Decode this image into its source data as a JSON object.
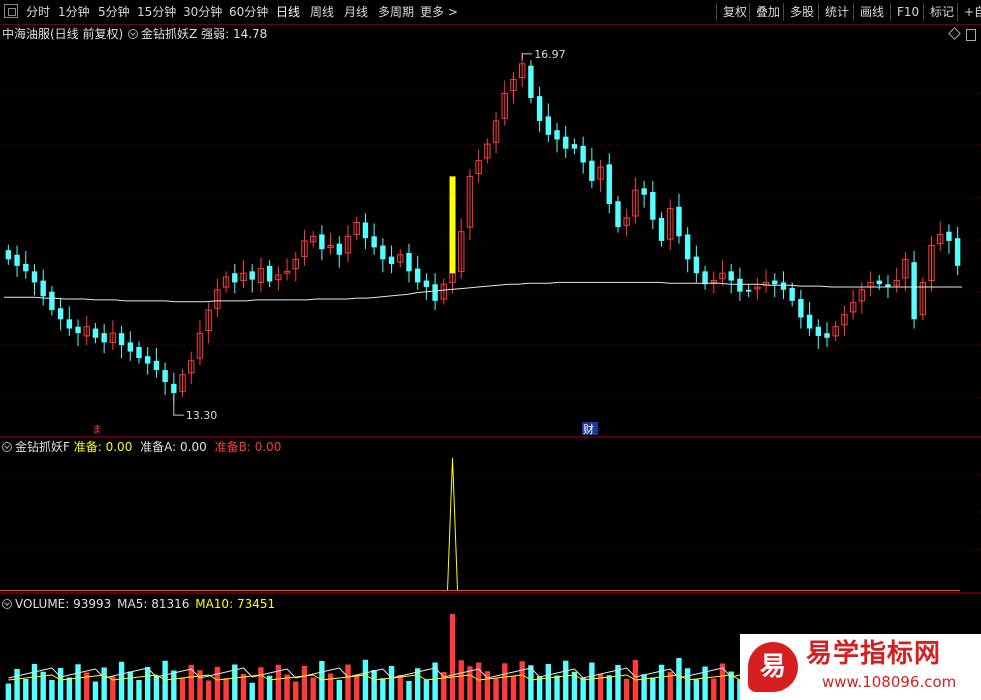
{
  "toolbar": {
    "periods": [
      "分时",
      "1分钟",
      "5分钟",
      "15分钟",
      "30分钟",
      "60分钟",
      "日线",
      "周线",
      "月线",
      "多周期",
      "更多 >"
    ],
    "active_period": "日线",
    "tools": [
      "复权",
      "叠加",
      "多股",
      "统计",
      "画线",
      "F10",
      "标记",
      "+自"
    ]
  },
  "main_panel": {
    "stock_name": "中海油服(日线 前复权)",
    "indicator_name": "金钻抓妖Z",
    "strength_label": "强弱:",
    "strength_value": "14.78",
    "high_label": "16.97",
    "low_label": "13.30",
    "marker_left": "ま",
    "marker_right": "财",
    "ylim": [
      13.0,
      17.25
    ],
    "ma_line": [
      14.44,
      14.44,
      14.44,
      14.44,
      14.43,
      14.43,
      14.42,
      14.42,
      14.42,
      14.41,
      14.41,
      14.41,
      14.4,
      14.4,
      14.4,
      14.4,
      14.4,
      14.39,
      14.39,
      14.39,
      14.39,
      14.4,
      14.4,
      14.4,
      14.4,
      14.41,
      14.41,
      14.41,
      14.41,
      14.41,
      14.41,
      14.42,
      14.42,
      14.42,
      14.42,
      14.43,
      14.43,
      14.44,
      14.45,
      14.46,
      14.47,
      14.49,
      14.5,
      14.51,
      14.52,
      14.53,
      14.54,
      14.55,
      14.56,
      14.57,
      14.58,
      14.58,
      14.59,
      14.59,
      14.59,
      14.6,
      14.6,
      14.6,
      14.6,
      14.6,
      14.6,
      14.6,
      14.6,
      14.6,
      14.6,
      14.6,
      14.59,
      14.59,
      14.59,
      14.59,
      14.59,
      14.59,
      14.58,
      14.58,
      14.58,
      14.58,
      14.57,
      14.57,
      14.57,
      14.56,
      14.56,
      14.56,
      14.55,
      14.55,
      14.55,
      14.55,
      14.55,
      14.55,
      14.55,
      14.55,
      14.55,
      14.55,
      14.55,
      14.55,
      14.55,
      14.55
    ],
    "colors": {
      "up": "#ff3b3b",
      "down": "#54ffff",
      "ma": "#e8e8e8",
      "signal": "#ffff00",
      "grid": "#6a0000"
    }
  },
  "chart_data": {
    "type": "candlestick",
    "close_series": [
      14.85,
      14.78,
      14.72,
      14.6,
      14.45,
      14.3,
      14.2,
      14.1,
      14.05,
      14.12,
      14.0,
      13.95,
      14.05,
      13.92,
      13.85,
      13.78,
      13.72,
      13.65,
      13.52,
      13.4,
      13.6,
      13.75,
      14.05,
      14.3,
      14.52,
      14.66,
      14.6,
      14.7,
      14.63,
      14.75,
      14.61,
      14.68,
      14.72,
      14.85,
      15.05,
      15.1,
      14.96,
      15.0,
      14.9,
      15.1,
      15.25,
      15.08,
      14.98,
      14.85,
      14.8,
      14.9,
      14.72,
      14.6,
      14.55,
      14.4,
      14.58,
      14.7,
      15.15,
      15.75,
      15.92,
      16.1,
      16.35,
      16.65,
      16.8,
      16.97,
      16.6,
      16.35,
      16.2,
      16.15,
      16.05,
      16.05,
      15.9,
      15.7,
      15.85,
      15.45,
      15.2,
      15.3,
      15.6,
      15.55,
      15.28,
      15.05,
      15.4,
      15.1,
      14.85,
      14.7,
      14.58,
      14.62,
      14.7,
      14.62,
      14.5,
      14.5,
      14.55,
      14.6,
      14.58,
      14.52,
      14.4,
      14.22,
      14.1,
      14.02,
      14.0,
      14.12,
      14.25,
      14.38,
      14.52,
      14.6,
      14.58,
      14.55,
      14.62,
      14.85,
      14.2,
      14.6,
      15.0,
      15.12,
      15.05,
      14.78
    ],
    "open_series": [
      14.95,
      14.9,
      14.8,
      14.72,
      14.62,
      14.5,
      14.32,
      14.2,
      14.12,
      14.02,
      14.1,
      14.05,
      13.95,
      14.05,
      13.95,
      13.9,
      13.8,
      13.75,
      13.65,
      13.5,
      13.42,
      13.62,
      13.78,
      14.08,
      14.32,
      14.55,
      14.7,
      14.62,
      14.72,
      14.6,
      14.78,
      14.63,
      14.7,
      14.75,
      14.88,
      15.04,
      15.12,
      14.98,
      15.02,
      14.92,
      15.12,
      15.25,
      15.1,
      15.0,
      14.88,
      14.82,
      14.92,
      14.75,
      14.62,
      14.58,
      14.42,
      14.6,
      14.72,
      15.2,
      15.78,
      15.95,
      16.12,
      16.38,
      16.68,
      16.82,
      16.95,
      16.62,
      16.4,
      16.25,
      16.18,
      16.1,
      16.08,
      15.92,
      15.72,
      15.88,
      15.48,
      15.22,
      15.32,
      15.62,
      15.58,
      15.3,
      15.07,
      15.42,
      15.12,
      14.88,
      14.72,
      14.6,
      14.64,
      14.72,
      14.64,
      14.52,
      14.53,
      14.57,
      14.62,
      14.6,
      14.54,
      14.42,
      14.25,
      14.12,
      14.05,
      14.02,
      14.14,
      14.28,
      14.4,
      14.55,
      14.62,
      14.58,
      14.57,
      14.65,
      14.82,
      14.25,
      14.62,
      15.02,
      15.15,
      15.08
    ],
    "signal_bar": {
      "index": 51,
      "from": 14.7,
      "to": 15.75
    },
    "volume_panel": {
      "label": "VOLUME:",
      "value": "93993",
      "ma5_label": "MA5:",
      "ma5": "81316",
      "ma10_label": "MA10:",
      "ma10": "73451"
    }
  },
  "indicator_panel": {
    "name": "金钻抓妖F",
    "l1": "准备:",
    "v1": "0.00",
    "l2": "准备A:",
    "v2": "0.00",
    "l3": "准备B:",
    "v3": "0.00"
  },
  "watermark": {
    "title": "易学指标网",
    "url": "www.108096.com",
    "badge": "易"
  }
}
